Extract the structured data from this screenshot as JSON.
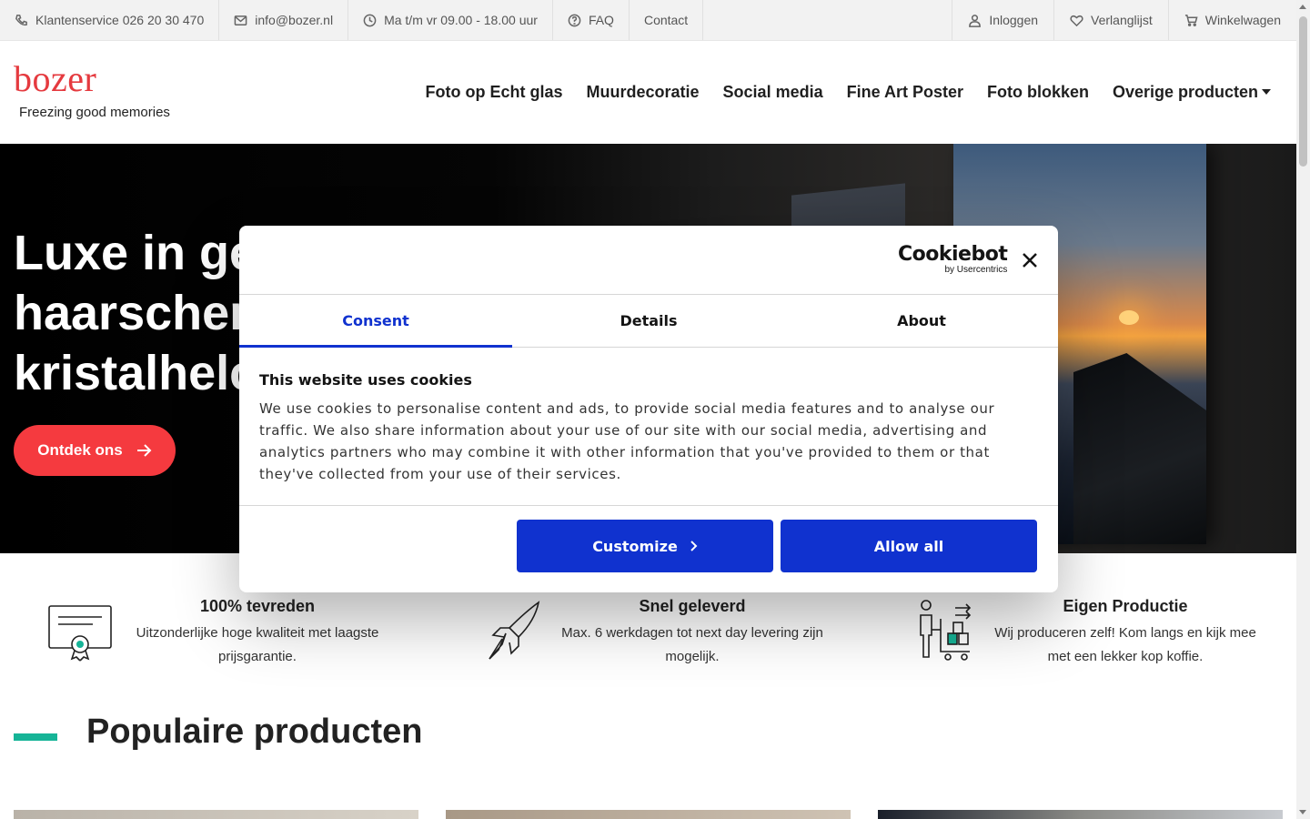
{
  "topbar": {
    "phone": "Klantenservice 026 20 30 470",
    "email": "info@bozer.nl",
    "hours": "Ma t/m vr 09.00 - 18.00 uur",
    "faq": "FAQ",
    "contact": "Contact",
    "login": "Inloggen",
    "wishlist": "Verlanglijst",
    "cart": "Winkelwagen"
  },
  "header": {
    "logo_word": "bozer",
    "logo_tagline": "Freezing good memories",
    "nav": [
      "Foto op Echt glas",
      "Muurdecoratie",
      "Social media",
      "Fine Art Poster",
      "Foto blokken",
      "Overige producten"
    ]
  },
  "hero": {
    "title": "Luxe in ge\nhaarscher\nkristalhelc",
    "button": "Ontdek ons"
  },
  "usps": [
    {
      "title": "100% tevreden",
      "desc": "Uitzonderlijke hoge kwaliteit met laagste prijsgarantie."
    },
    {
      "title": "Snel geleverd",
      "desc": "Max. 6 werkdagen tot next day levering zijn mogelijk."
    },
    {
      "title": "Eigen Productie",
      "desc": "Wij produceren zelf! Kom langs en kijk mee met een lekker kop koffie."
    }
  ],
  "popular": {
    "title": "Populaire producten"
  },
  "cookie": {
    "brand": "Cookiebot",
    "brand_sub": "by Usercentrics",
    "tabs": [
      "Consent",
      "Details",
      "About"
    ],
    "title": "This website uses cookies",
    "text": "We use cookies to personalise content and ads, to provide social media features and to analyse our traffic. We also share information about your use of our site with our social media, advertising and analytics partners who may combine it with other information that you've provided to them or that they've collected from your use of their services.",
    "customize": "Customize",
    "allow_all": "Allow all",
    "accent": "#1032cf"
  },
  "colors": {
    "brand_red": "#f53a3f",
    "teal": "#16b497"
  }
}
